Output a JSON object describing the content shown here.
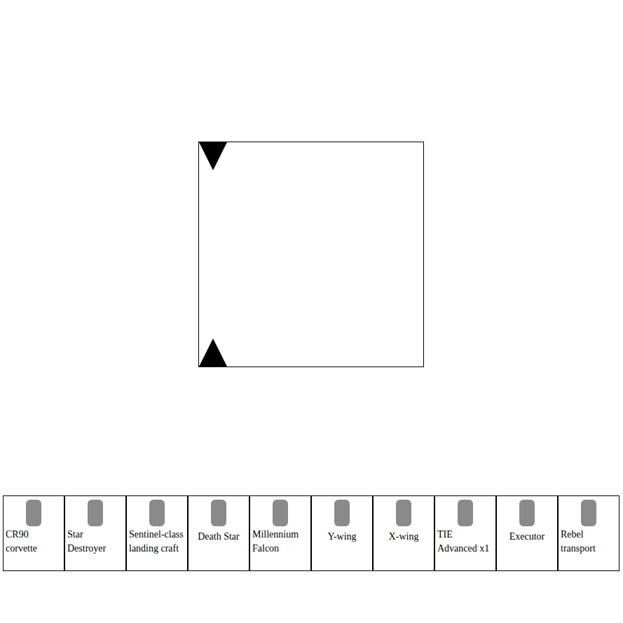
{
  "board": {
    "markers": [
      {
        "direction": "down"
      },
      {
        "direction": "up"
      }
    ]
  },
  "palette": [
    {
      "name": "CR90 corvette"
    },
    {
      "name": "Star Destroyer"
    },
    {
      "name": "Sentinel-class landing craft"
    },
    {
      "name": "Death Star"
    },
    {
      "name": "Millennium Falcon"
    },
    {
      "name": "Y-wing"
    },
    {
      "name": "X-wing"
    },
    {
      "name": "TIE Advanced x1"
    },
    {
      "name": "Executor"
    },
    {
      "name": "Rebel transport"
    }
  ]
}
